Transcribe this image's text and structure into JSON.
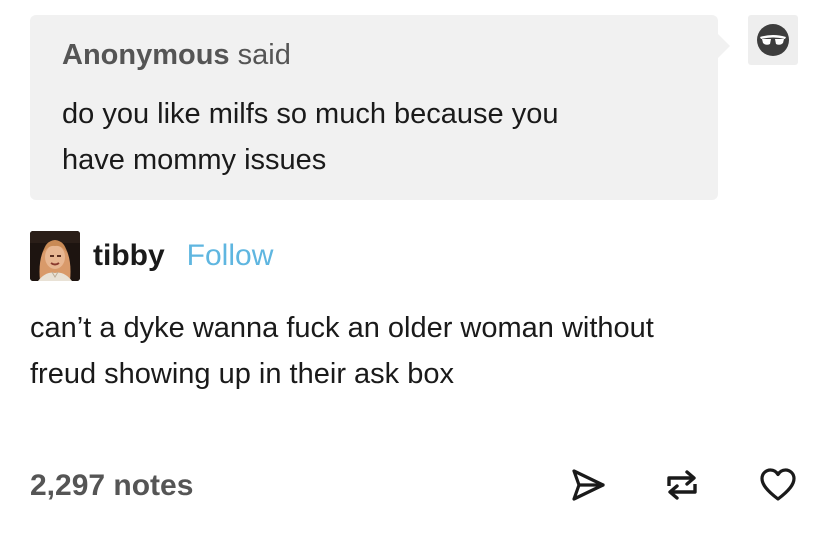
{
  "ask": {
    "asker_name": "Anonymous",
    "asker_verb": "said",
    "question_line1": "do you like milfs so much because you",
    "question_line2": "have mommy issues",
    "avatar_icon": "anonymous-sunglasses-icon"
  },
  "post": {
    "blog_name": "tibby",
    "follow_label": "Follow",
    "body_line1": "can’t a dyke wanna fuck an older woman without",
    "body_line2": "freud showing up in their ask box"
  },
  "footer": {
    "notes": "2,297 notes",
    "icons": [
      "share-icon",
      "reblog-icon",
      "heart-icon"
    ]
  },
  "colors": {
    "follow": "#5fb6e0",
    "ask_background": "#f1f1f1",
    "text": "#1a1a1a",
    "muted": "#555555"
  }
}
